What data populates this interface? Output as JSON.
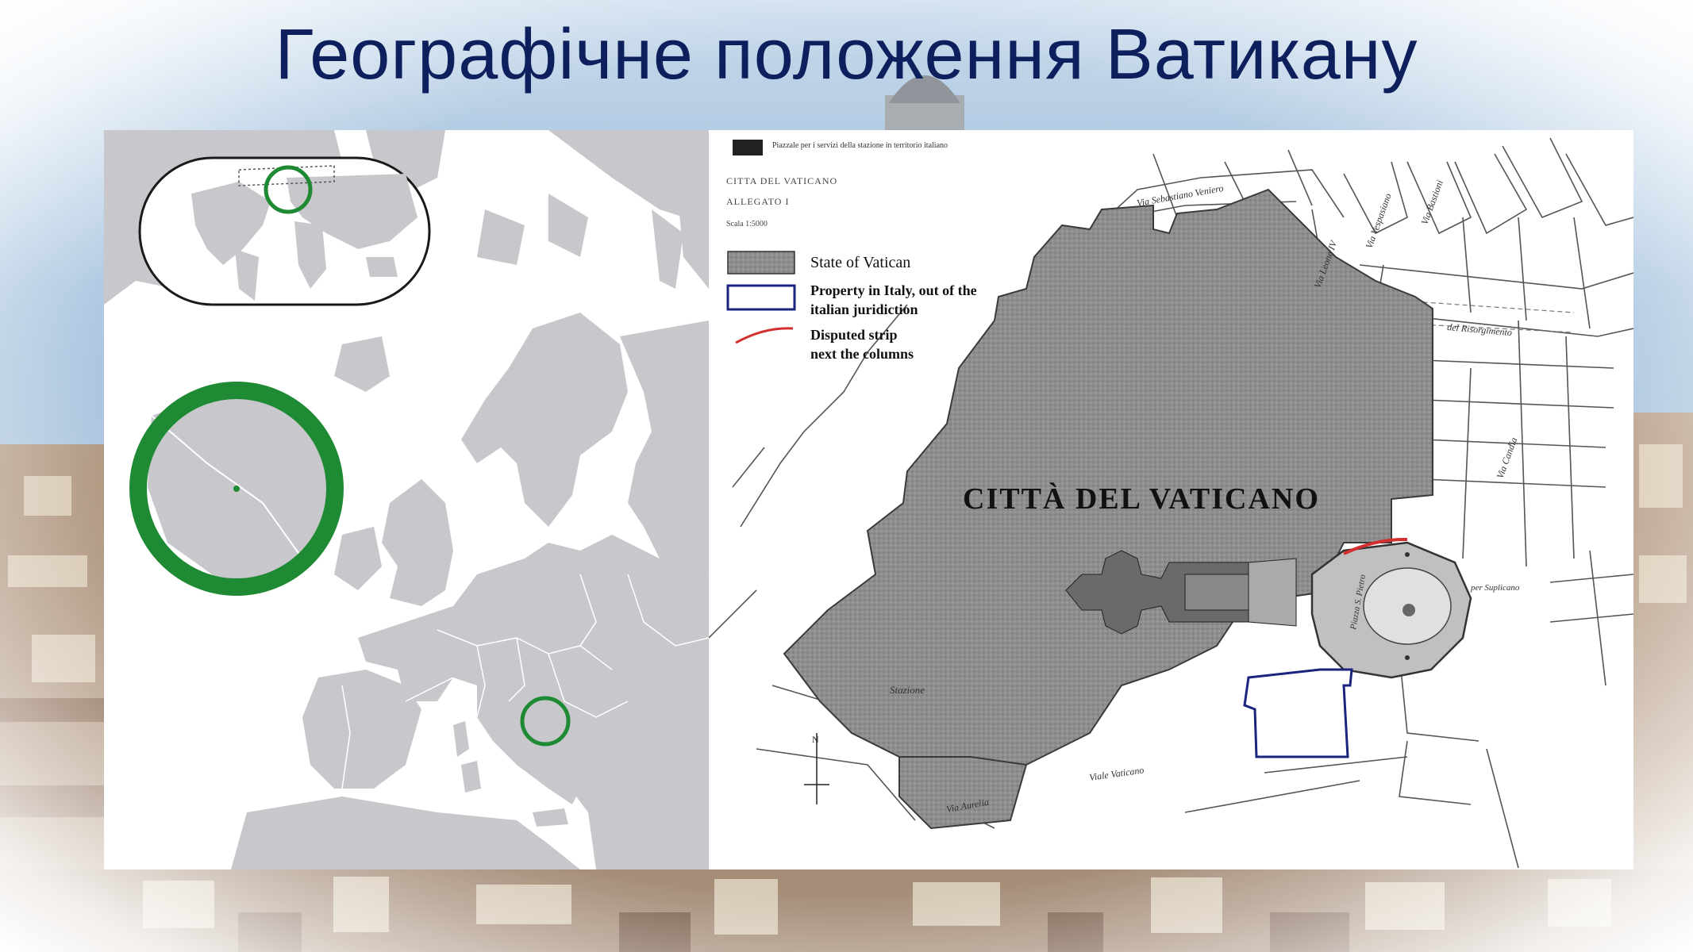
{
  "slide": {
    "title": "Географічне положення Ватикану"
  },
  "map_right": {
    "header_note": "Piazzale per i servizi della stazione in territorio italiano",
    "doc_title": "CITTA DEL VATICANO",
    "doc_subtitle": "ALLEGATO I",
    "doc_scale": "Scala 1:5000",
    "main_label": "CITTÀ DEL VATICANO",
    "legend": [
      {
        "label_line1": "State of Vatican",
        "label_line2": "",
        "swatch": "gray-fill"
      },
      {
        "label_line1": "Property in Italy,  out of the",
        "label_line2": "italian  juridiction",
        "swatch": "blue-outline"
      },
      {
        "label_line1": "Disputed  strip",
        "label_line2": "next the columns",
        "swatch": "red-line"
      }
    ],
    "street_labels": [
      "Via Sebastiano Veniero",
      "Via Leone IV",
      "Via Vespasiano",
      "Via Bastioni",
      "del Risorgimento",
      "Via Candia",
      "Viale Vaticano",
      "Via Aurelia",
      "Stazione",
      "Piazza S. Pietro",
      "per Suplicano"
    ],
    "compass_label": "N"
  },
  "colors": {
    "title": "#0d1f5c",
    "vatican_fill": "#8e8e8e",
    "europe_land": "#c8c8cc",
    "highlight_circle": "#1e8a34",
    "property_outline": "#1a237e",
    "disputed_strip": "#d32f2f"
  }
}
